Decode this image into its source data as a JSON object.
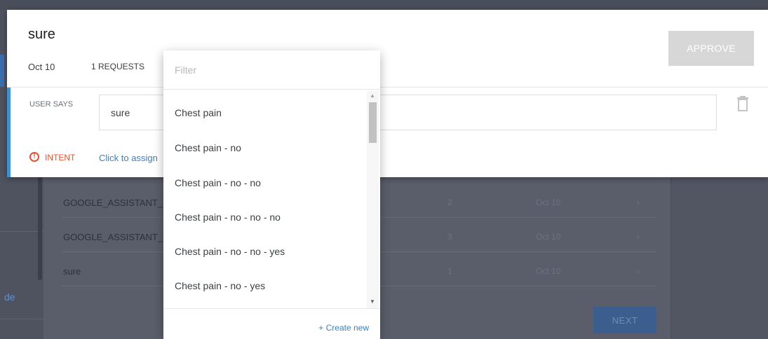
{
  "background": {
    "sidebar_link_fragment": "de",
    "rows": [
      {
        "name": "GOOGLE_ASSISTANT_",
        "count": "2",
        "date": "Oct 10",
        "arrow": "›"
      },
      {
        "name": "GOOGLE_ASSISTANT_",
        "count": "3",
        "date": "Oct 10",
        "arrow": "›"
      },
      {
        "name": "sure",
        "count": "1",
        "date": "Oct 10",
        "arrow": "›"
      }
    ],
    "next_label": "NEXT"
  },
  "modal": {
    "title": "sure",
    "date": "Oct 10",
    "requests": "1 REQUESTS",
    "approve_label": "APPROVE",
    "user_says_label": "USER SAYS",
    "user_says_value": "sure",
    "intent_label": "INTENT",
    "assign_link": "Click to assign"
  },
  "dropdown": {
    "filter_placeholder": "Filter",
    "options": [
      "Chest pain",
      "Chest pain - no",
      "Chest pain - no - no",
      "Chest pain - no - no - no",
      "Chest pain - no - no - yes",
      "Chest pain - no - yes"
    ],
    "create_new_label": "+ Create new"
  },
  "colors": {
    "accent_blue": "#3d92d6",
    "warning_red": "#e8512f",
    "link_blue": "#3d7ec9",
    "disabled_button": "#d7d7d7"
  }
}
